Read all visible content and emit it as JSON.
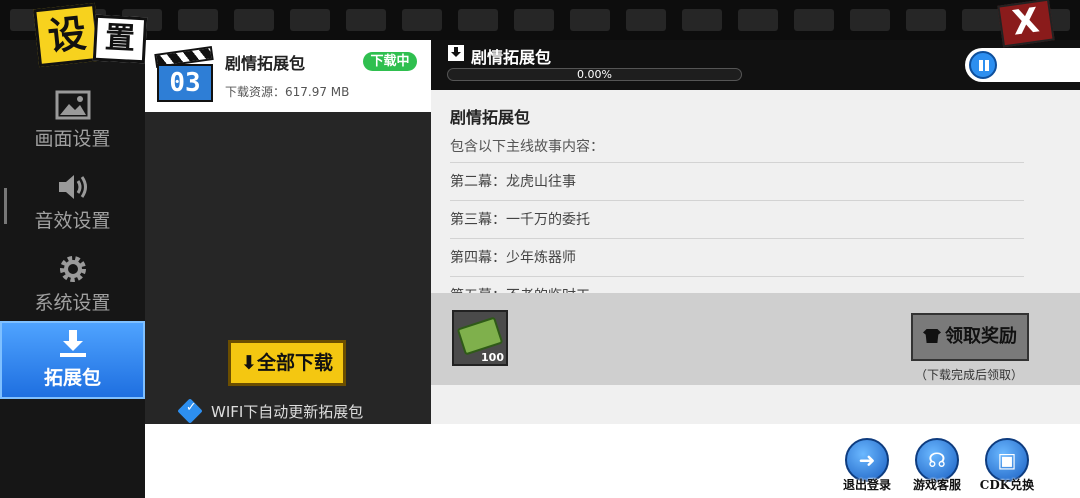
{
  "header": {
    "title_chars": [
      "设",
      "置"
    ],
    "close_glyph": "X"
  },
  "sidebar": {
    "items": [
      {
        "label": "画面设置",
        "icon": "image-icon"
      },
      {
        "label": "音效设置",
        "icon": "speaker-icon"
      },
      {
        "label": "系统设置",
        "icon": "gear-icon"
      },
      {
        "label": "拓展包",
        "icon": "download-icon",
        "active": true
      }
    ]
  },
  "pack": {
    "number": "03",
    "name": "剧情拓展包",
    "size": "下载资源：617.97 MB",
    "badge": "下载中"
  },
  "list": {
    "download_all": "全部下载",
    "wifi_label": "WIFI下自动更新拓展包",
    "wifi_checked": true
  },
  "detail": {
    "header_title": "剧情拓展包",
    "progress_text": "0.00%",
    "progress_value": 0.0,
    "content_title": "剧情拓展包",
    "intro": "包含以下主线故事内容：",
    "chapters": [
      "第二幕：龙虎山往事",
      "第三幕：一千万的委托",
      "第四幕：少年炼器师",
      "第五幕：不老的临时工"
    ]
  },
  "reward": {
    "count": "100",
    "claim_label": "领取奖励",
    "claim_note": "（下载完成后领取）"
  },
  "bottom": {
    "logout": "退出登录",
    "support": "游戏客服",
    "cdk": "CDK兑换"
  },
  "colors": {
    "accent_blue": "#2d8ff0",
    "badge_green": "#2fbf4f",
    "button_yellow": "#f4c711",
    "close_red": "#8a1b1b"
  }
}
